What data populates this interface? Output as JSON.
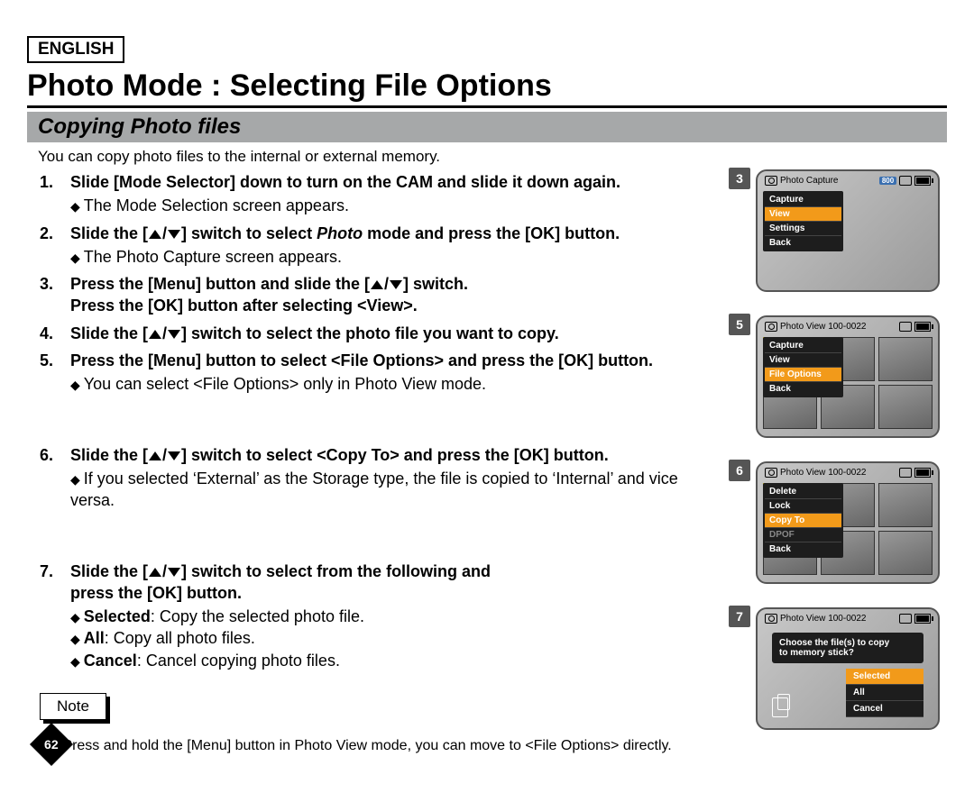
{
  "lang": "ENGLISH",
  "main_title": "Photo Mode : Selecting File Options",
  "sub_title": "Copying Photo files",
  "intro": "You can copy photo files to the internal or external memory.",
  "steps": [
    {
      "num": "1.",
      "bold": "Slide [Mode Selector] down to turn on the CAM and slide it down again.",
      "sub": "The Mode Selection screen appears."
    },
    {
      "num": "2.",
      "bold_pre": "Slide the [",
      "bold_mid": "] switch to select ",
      "italic": "Photo",
      "bold_post": " mode and press the [OK] button.",
      "sub": "The Photo Capture screen appears."
    },
    {
      "num": "3.",
      "line1_pre": "Press the [Menu] button and slide the [",
      "line1_post": "] switch.",
      "line2": "Press the [OK] button after selecting <View>."
    },
    {
      "num": "4.",
      "bold_pre": "Slide the [",
      "bold_post": "] switch to select the photo file you want to copy."
    },
    {
      "num": "5.",
      "bold": "Press the [Menu] button to select <File Options> and press the [OK] button.",
      "sub": "You can select <File Options> only in Photo View mode."
    },
    {
      "num": "6.",
      "bold_pre": "Slide the [",
      "bold_post": "] switch to select <Copy To> and press the [OK] button.",
      "sub": "If you selected ‘External’ as the Storage type, the file is copied to ‘Internal’ and vice versa."
    },
    {
      "num": "7.",
      "bold_pre": "Slide the [",
      "bold_mid": "] switch to select from the following and",
      "line2": "press the [OK] button.",
      "opts": [
        {
          "name": "Selected",
          "desc": ": Copy the selected photo file."
        },
        {
          "name": "All",
          "desc": ": Copy all photo files."
        },
        {
          "name": "Cancel",
          "desc": ": Cancel copying photo files."
        }
      ]
    }
  ],
  "note_label": "Note",
  "note_text": "Press and hold the [Menu] button in Photo View mode, you can move to <File Options> directly.",
  "page_number": "62",
  "screens": {
    "s3": {
      "num": "3",
      "title": "Photo Capture",
      "badge": "800",
      "menu": [
        "Capture",
        "View",
        "Settings",
        "Back"
      ],
      "selected": "View"
    },
    "s5": {
      "num": "5",
      "title": "Photo View",
      "counter": "100-0022",
      "menu": [
        "Capture",
        "View",
        "File Options",
        "Back"
      ],
      "selected": "File Options"
    },
    "s6": {
      "num": "6",
      "title": "Photo View",
      "counter": "100-0022",
      "menu": [
        "Delete",
        "Lock",
        "Copy To",
        "DPOF",
        "Back"
      ],
      "selected": "Copy To",
      "dimmed": "DPOF"
    },
    "s7": {
      "num": "7",
      "title": "Photo View",
      "counter": "100-0022",
      "prompt1": "Choose the file(s) to copy",
      "prompt2": "to memory stick?",
      "options": [
        "Selected",
        "All",
        "Cancel"
      ],
      "selected": "Selected"
    }
  }
}
